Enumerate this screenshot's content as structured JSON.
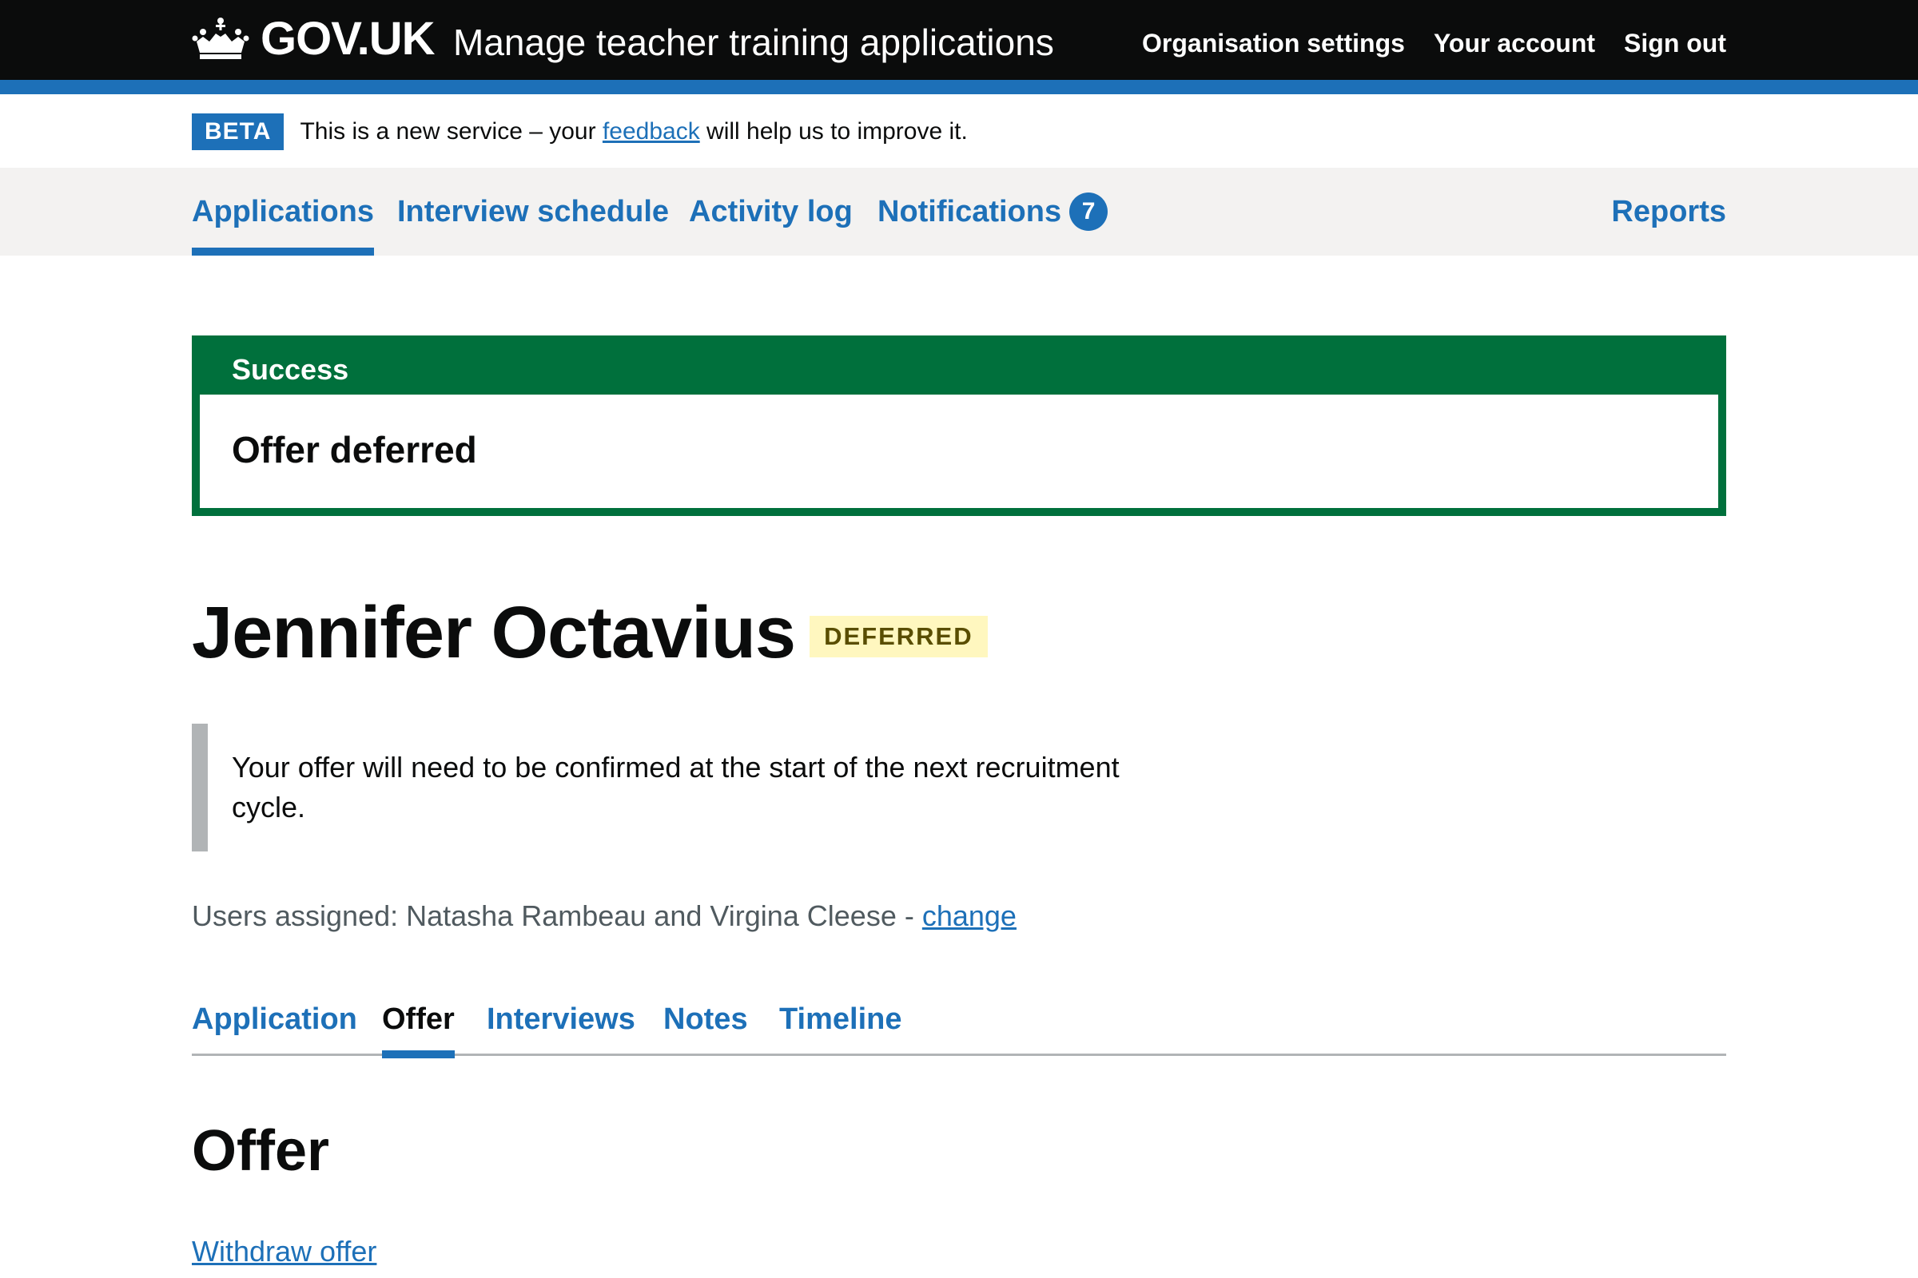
{
  "header": {
    "logo_text": "GOV.UK",
    "service_name": "Manage teacher training applications",
    "nav": [
      "Organisation settings",
      "Your account",
      "Sign out"
    ]
  },
  "phase_banner": {
    "tag": "BETA",
    "text_before": "This is a new service – your ",
    "link": "feedback",
    "text_after": " will help us to improve it."
  },
  "primary_nav": {
    "items": [
      "Applications",
      "Interview schedule",
      "Activity log",
      "Notifications"
    ],
    "notifications_count": "7",
    "reports": "Reports",
    "active": "Applications"
  },
  "success_banner": {
    "title": "Success",
    "heading": "Offer deferred"
  },
  "candidate": {
    "name": "Jennifer Octavius",
    "status": "DEFERRED"
  },
  "inset_text": "Your offer will need to be confirmed at the start of the next recruitment cycle.",
  "assigned": {
    "text": "Users assigned: Natasha Rambeau and Virgina Cleese - ",
    "link": "change"
  },
  "sub_nav": {
    "items": [
      "Application",
      "Offer",
      "Interviews",
      "Notes",
      "Timeline"
    ],
    "active": "Offer"
  },
  "section": {
    "heading": "Offer",
    "withdraw_link": "Withdraw offer"
  },
  "colors": {
    "header": "#0b0c0c",
    "brand_blue": "#1d70b8",
    "success_green": "#00703c",
    "tag_yellow": "#fff7bf",
    "nav_grey": "#f3f2f1"
  }
}
